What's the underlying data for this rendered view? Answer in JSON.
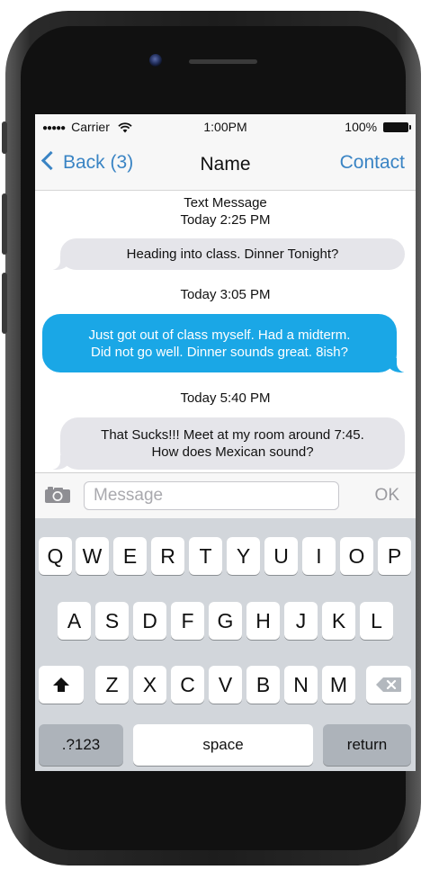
{
  "status_bar": {
    "signal": "●●●●●",
    "carrier": "Carrier",
    "time": "1:00PM",
    "battery": "100%"
  },
  "nav": {
    "back_label": "Back (3)",
    "title": "Name",
    "contact_label": "Contact",
    "accent_color": "#3a84c4"
  },
  "conversation": {
    "header": "Text Message",
    "messages": [
      {
        "timestamp": "Today 2:25 PM",
        "direction": "incoming",
        "text_lines": [
          "Heading into class. Dinner Tonight?"
        ]
      },
      {
        "timestamp": "Today 3:05 PM",
        "direction": "outgoing",
        "text_lines": [
          "Just got out of class myself. Had a midterm.",
          "Did not go well. Dinner sounds great. 8ish?"
        ]
      },
      {
        "timestamp": "Today 5:40 PM",
        "direction": "incoming",
        "text_lines": [
          "That Sucks!!! Meet at my room around 7:45.",
          "How does Mexican sound?"
        ]
      }
    ],
    "outgoing_color": "#1aa7e6",
    "incoming_color": "#e5e5ea"
  },
  "input_bar": {
    "placeholder": "Message",
    "value": "",
    "send_label": "OK",
    "camera_icon": "camera-icon"
  },
  "keyboard": {
    "row1": [
      "Q",
      "W",
      "E",
      "R",
      "T",
      "Y",
      "U",
      "I",
      "O",
      "P"
    ],
    "row2": [
      "A",
      "S",
      "D",
      "F",
      "G",
      "H",
      "J",
      "K",
      "L"
    ],
    "row3": [
      "Z",
      "X",
      "C",
      "V",
      "B",
      "N",
      "M"
    ],
    "shift_icon": "shift-arrow-icon",
    "delete_icon": "backspace-icon",
    "numbers_label": ".?123",
    "space_label": "space",
    "return_label": "return"
  }
}
